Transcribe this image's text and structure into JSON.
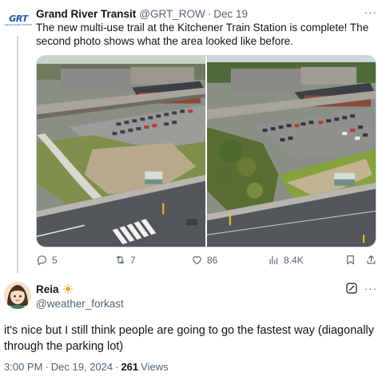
{
  "post": {
    "avatar_logo_text": "GRT",
    "avatar_logo_sub": "GRAND RIVER TRANSIT",
    "display_name": "Grand River Transit",
    "handle": "@GRT_ROW",
    "separator": "·",
    "date": "Dec 19",
    "more_icon": "···",
    "text": "The new multi-use trail at the Kitchener Train Station is complete! The second photo shows what the area looked like before.",
    "photos": [
      {
        "name": "after-photo"
      },
      {
        "name": "before-photo"
      }
    ],
    "actions": {
      "replies": "5",
      "reposts": "7",
      "likes": "86",
      "views": "8.4K"
    }
  },
  "reply": {
    "display_name": "Reia",
    "badge_icon": "sun-emoji",
    "handle": "@weather_forkast",
    "more_icon": "···",
    "text": "it's nice but I still think people are going to go the fastest way (diagonally through the parking lot)",
    "time": "3:00 PM",
    "separator": "·",
    "date": "Dec 19, 2024",
    "separator2": "·",
    "views_count": "261",
    "views_label": "Views"
  },
  "colors": {
    "text_primary": "#0f1419",
    "text_secondary": "#536471",
    "thread_line": "#cfd9de",
    "grt_blue": "#1e5aa8",
    "badge_gold": "#f5a623"
  }
}
